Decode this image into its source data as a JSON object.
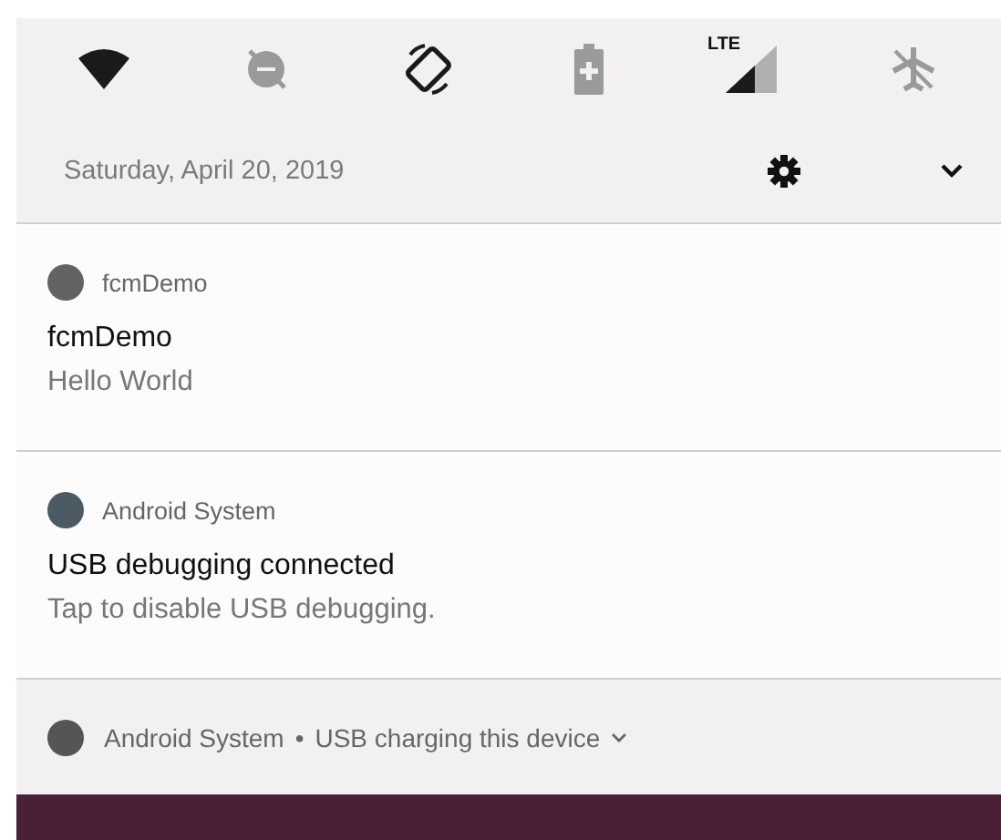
{
  "quick_settings": {
    "tiles": [
      {
        "kind": "wifi",
        "on": true
      },
      {
        "kind": "data-saver",
        "on": false
      },
      {
        "kind": "rotate",
        "on": true
      },
      {
        "kind": "battery-saver",
        "on": false
      },
      {
        "kind": "cellular",
        "on": true,
        "label": "LTE"
      },
      {
        "kind": "airplane",
        "on": false
      }
    ],
    "date": "Saturday, April 20, 2019"
  },
  "notifications": [
    {
      "kind": "expanded",
      "app": "fcmDemo",
      "color": "#636363",
      "title": "fcmDemo",
      "text": "Hello World"
    },
    {
      "kind": "expanded",
      "app": "Android System",
      "color": "#4b5a63",
      "title": "USB debugging connected",
      "text": "Tap to disable USB debugging."
    },
    {
      "kind": "collapsed",
      "app": "Android System",
      "color": "#555555",
      "separator": "•",
      "title": "USB charging this device"
    }
  ]
}
